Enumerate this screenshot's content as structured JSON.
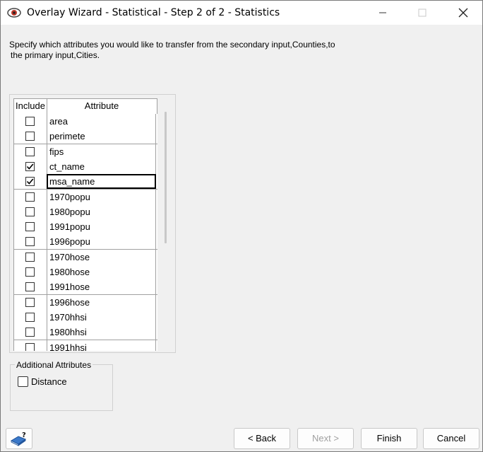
{
  "window": {
    "title": "Overlay Wizard - Statistical - Step 2 of 2 - Statistics",
    "icon": "eye-icon"
  },
  "description": {
    "line1": "Specify which attributes you would like to transfer from the secondary input,Counties,to",
    "line2": "the primary input,Cities."
  },
  "grid": {
    "headers": {
      "include": "Include",
      "attribute": "Attribute"
    },
    "rows": [
      {
        "checked": false,
        "attribute": "area"
      },
      {
        "checked": false,
        "attribute": "perimete"
      },
      {
        "checked": false,
        "attribute": "fips"
      },
      {
        "checked": true,
        "attribute": "ct_name"
      },
      {
        "checked": true,
        "attribute": "msa_name",
        "selected": true
      },
      {
        "checked": false,
        "attribute": "1970popu"
      },
      {
        "checked": false,
        "attribute": "1980popu"
      },
      {
        "checked": false,
        "attribute": "1991popu"
      },
      {
        "checked": false,
        "attribute": "1996popu"
      },
      {
        "checked": false,
        "attribute": "1970hose"
      },
      {
        "checked": false,
        "attribute": "1980hose"
      },
      {
        "checked": false,
        "attribute": "1991hose"
      },
      {
        "checked": false,
        "attribute": "1996hose"
      },
      {
        "checked": false,
        "attribute": "1970hhsi"
      },
      {
        "checked": false,
        "attribute": "1980hhsi"
      },
      {
        "checked": false,
        "attribute": "1991hhsi"
      }
    ]
  },
  "additional": {
    "title": "Additional Attributes",
    "distance_label": "Distance",
    "distance_checked": false
  },
  "buttons": {
    "help_icon": "help-book-icon",
    "back": "< Back",
    "next": "Next >",
    "finish": "Finish",
    "cancel": "Cancel"
  }
}
